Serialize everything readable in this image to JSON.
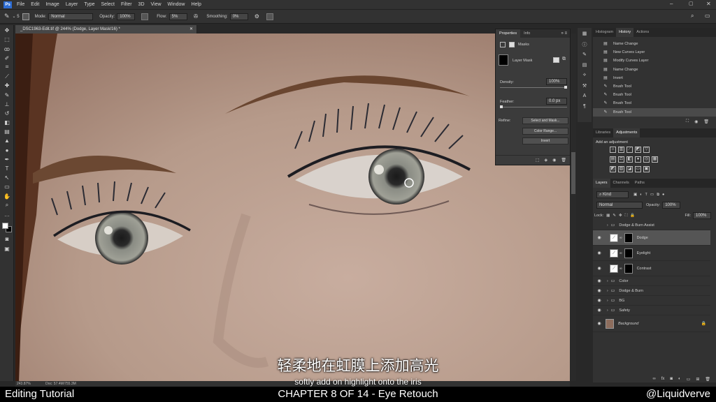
{
  "menubar": {
    "items": [
      "File",
      "Edit",
      "Image",
      "Layer",
      "Type",
      "Select",
      "Filter",
      "3D",
      "View",
      "Window",
      "Help"
    ]
  },
  "options": {
    "mode_label": "Mode:",
    "mode_value": "Normal",
    "opacity_label": "Opacity:",
    "opacity_value": "100%",
    "flow_label": "Flow:",
    "flow_value": "5%",
    "smoothing_label": "Smoothing:",
    "smoothing_value": "0%"
  },
  "document": {
    "tab_title": "_DSC1963-Edit.tif @ 244% (Dodge, Layer Mask/16) *",
    "zoom": "243.87%",
    "doc_info": "Doc: 57.4M/755.3M"
  },
  "properties": {
    "tabs": [
      "Properties",
      "Info"
    ],
    "section": "Masks",
    "mask_label": "Layer Mask",
    "density_label": "Density:",
    "density_value": "100%",
    "density_level": 1.0,
    "feather_label": "Feather:",
    "feather_value": "0.0 px",
    "feather_level": 0.0,
    "refine_label": "Refine:",
    "buttons": [
      "Select and Mask...",
      "Color Range...",
      "Invert"
    ]
  },
  "history": {
    "tabs": [
      "Histogram",
      "History",
      "Actions"
    ],
    "items": [
      "Name Change",
      "New Curves Layer",
      "Modify Curves Layer",
      "Name Change",
      "Invert",
      "Brush Tool",
      "Brush Tool",
      "Brush Tool",
      "Brush Tool"
    ],
    "selected_index": 8
  },
  "adjustments": {
    "tabs": [
      "Libraries",
      "Adjustments"
    ],
    "title": "Add an adjustment"
  },
  "layers": {
    "tabs": [
      "Layers",
      "Channels",
      "Paths"
    ],
    "filter_value": "Kind",
    "blend_value": "Normal",
    "opacity_label": "Opacity:",
    "opacity_value": "100%",
    "lock_label": "Lock:",
    "fill_label": "Fill:",
    "fill_value": "100%",
    "rows": [
      {
        "name": "Dodge & Burn Assist",
        "type": "group",
        "visible": false
      },
      {
        "name": "Dodge",
        "type": "curves",
        "visible": true,
        "selected": true
      },
      {
        "name": "Eyelight",
        "type": "curves",
        "visible": true
      },
      {
        "name": "Contrast",
        "type": "curves",
        "visible": true
      },
      {
        "name": "Color",
        "type": "group",
        "visible": true
      },
      {
        "name": "Dodge & Burn",
        "type": "group",
        "visible": true
      },
      {
        "name": "BG",
        "type": "group",
        "visible": true
      },
      {
        "name": "Safety",
        "type": "group",
        "visible": true
      },
      {
        "name": "Background",
        "type": "image",
        "visible": true
      }
    ]
  },
  "subtitle": {
    "cn": "轻柔地在虹膜上添加高光",
    "en": "softly add on highlight onto the iris"
  },
  "footer": {
    "left": "Editing Tutorial",
    "center": "CHAPTER 8 OF 14 - Eye Retouch",
    "right": "@Liquidverve"
  }
}
